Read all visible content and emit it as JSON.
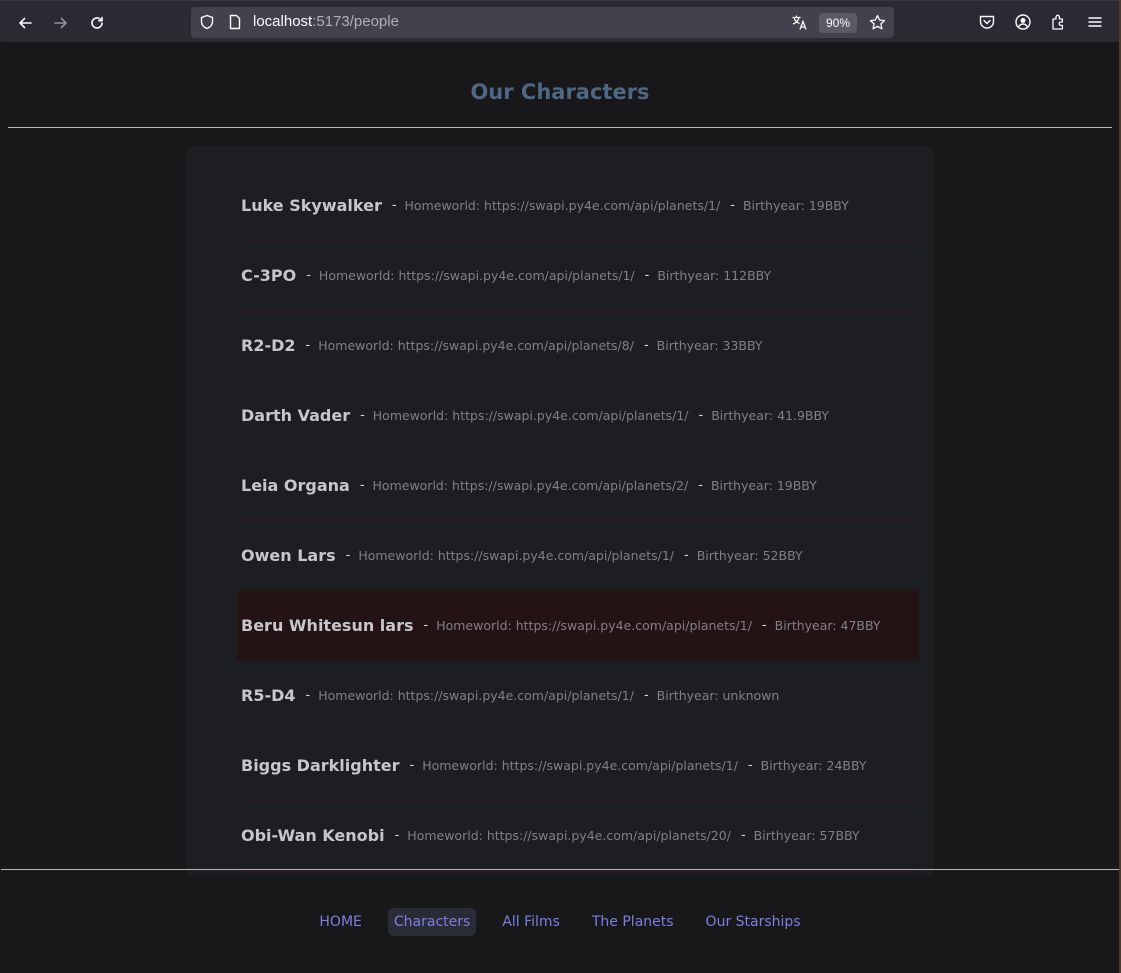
{
  "browser": {
    "url_host": "localhost",
    "url_path": ":5173/people",
    "zoom": "90%"
  },
  "page": {
    "title": "Our Characters",
    "people": [
      {
        "name": "Luke Skywalker",
        "homeworld": "Homeworld: https://swapi.py4e.com/api/planets/1/",
        "birthyear": "Birthyear: 19BBY"
      },
      {
        "name": "C-3PO",
        "homeworld": "Homeworld: https://swapi.py4e.com/api/planets/1/",
        "birthyear": "Birthyear: 112BBY"
      },
      {
        "name": "R2-D2",
        "homeworld": "Homeworld: https://swapi.py4e.com/api/planets/8/",
        "birthyear": "Birthyear: 33BBY"
      },
      {
        "name": "Darth Vader",
        "homeworld": "Homeworld: https://swapi.py4e.com/api/planets/1/",
        "birthyear": "Birthyear: 41.9BBY"
      },
      {
        "name": "Leia Organa",
        "homeworld": "Homeworld: https://swapi.py4e.com/api/planets/2/",
        "birthyear": "Birthyear: 19BBY"
      },
      {
        "name": "Owen Lars",
        "homeworld": "Homeworld: https://swapi.py4e.com/api/planets/1/",
        "birthyear": "Birthyear: 52BBY"
      },
      {
        "name": "Beru Whitesun lars",
        "homeworld": "Homeworld: https://swapi.py4e.com/api/planets/1/",
        "birthyear": "Birthyear: 47BBY"
      },
      {
        "name": "R5-D4",
        "homeworld": "Homeworld: https://swapi.py4e.com/api/planets/1/",
        "birthyear": "Birthyear: unknown"
      },
      {
        "name": "Biggs Darklighter",
        "homeworld": "Homeworld: https://swapi.py4e.com/api/planets/1/",
        "birthyear": "Birthyear: 24BBY"
      },
      {
        "name": "Obi-Wan Kenobi",
        "homeworld": "Homeworld: https://swapi.py4e.com/api/planets/20/",
        "birthyear": "Birthyear: 57BBY"
      }
    ],
    "separator": "-",
    "highlighted_index": 6
  },
  "footer": {
    "links": [
      "HOME",
      "Characters",
      "All Films",
      "The Planets",
      "Our Starships"
    ],
    "active_index": 1
  },
  "colors": {
    "title": "#4d6784",
    "link": "#7e7fe0",
    "row_highlight": "#231315"
  }
}
